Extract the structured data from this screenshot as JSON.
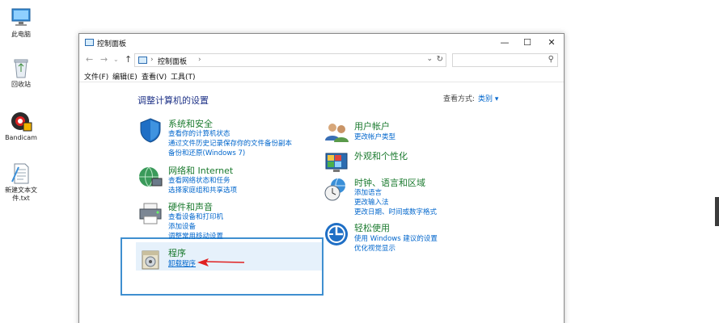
{
  "desktop": {
    "icons": [
      {
        "label": "此电脑",
        "icon": "computer-icon"
      },
      {
        "label": "回收站",
        "icon": "recycle-bin-icon"
      },
      {
        "label": "Bandicam",
        "icon": "bandicam-icon"
      },
      {
        "label": "新建文本文",
        "label2": "件.txt",
        "icon": "text-file-icon"
      }
    ]
  },
  "window": {
    "title": "控制面板",
    "controls": {
      "minimize": "—",
      "maximize": "☐",
      "close": "✕"
    },
    "address": {
      "crumb": "控制面板",
      "sep": "›"
    },
    "search": {
      "placeholder": ""
    },
    "menu": [
      "文件(F)",
      "编辑(E)",
      "查看(V)",
      "工具(T)"
    ]
  },
  "content": {
    "heading": "调整计算机的设置",
    "view_by_label": "查看方式:",
    "view_by_value": "类别 ▾",
    "left_categories": [
      {
        "title": "系统和安全",
        "links": [
          "查看你的计算机状态",
          "通过文件历史记录保存你的文件备份副本",
          "备份和还原(Windows 7)"
        ],
        "icon": "shield-icon"
      },
      {
        "title": "网络和 Internet",
        "links": [
          "查看网络状态和任务",
          "选择家庭组和共享选项"
        ],
        "icon": "network-globe-icon"
      },
      {
        "title": "硬件和声音",
        "links": [
          "查看设备和打印机",
          "添加设备",
          "调整常用移动设置"
        ],
        "icon": "printer-icon"
      },
      {
        "title": "程序",
        "links": [
          "卸载程序"
        ],
        "icon": "programs-icon"
      }
    ],
    "right_categories": [
      {
        "title": "用户帐户",
        "links": [
          "更改帐户类型"
        ],
        "icon": "users-icon"
      },
      {
        "title": "外观和个性化",
        "links": [],
        "icon": "appearance-icon"
      },
      {
        "title": "时钟、语言和区域",
        "links": [
          "添加语言",
          "更改输入法",
          "更改日期、时间或数字格式"
        ],
        "icon": "clock-globe-icon"
      },
      {
        "title": "轻松使用",
        "links": [
          "使用 Windows 建议的设置",
          "优化视觉显示"
        ],
        "icon": "ease-of-access-icon"
      }
    ]
  },
  "colors": {
    "category_title": "#1a7a2e",
    "link": "#0066cc",
    "heading": "#1e3287",
    "highlight": "#3f8fd0",
    "arrow": "#e02020"
  }
}
